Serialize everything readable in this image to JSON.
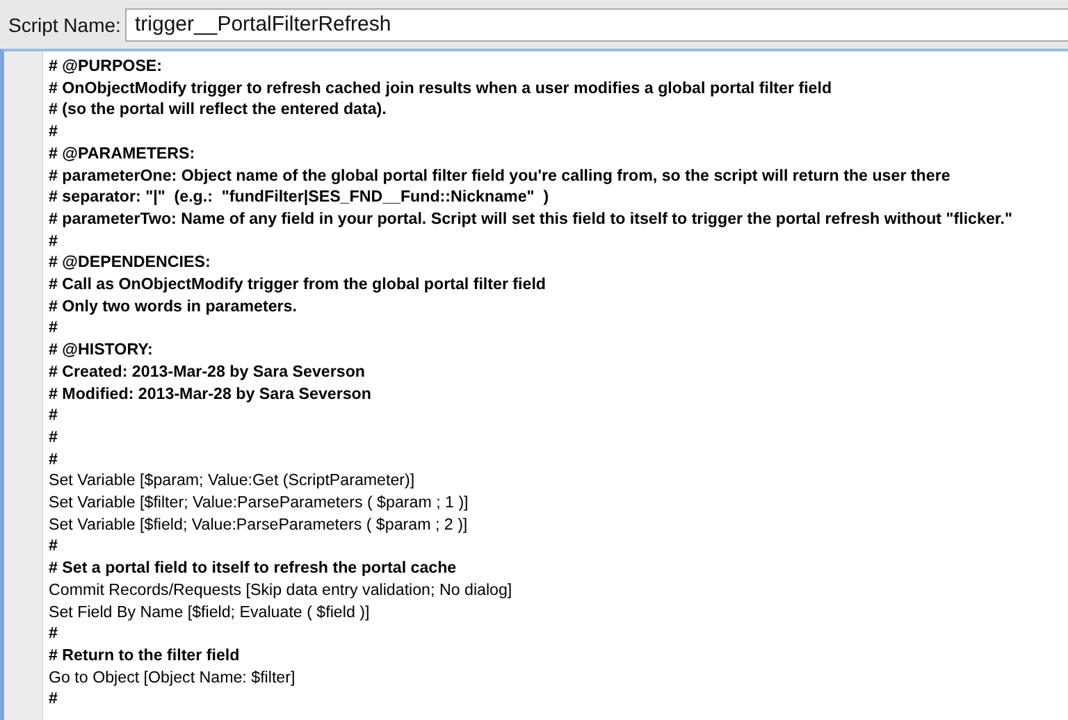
{
  "script_name": {
    "label": "Script Name:",
    "value": "trigger__PortalFilterRefresh"
  },
  "script_lines": [
    {
      "kind": "comment",
      "text": "# @PURPOSE:"
    },
    {
      "kind": "comment",
      "text": "# OnObjectModify trigger to refresh cached join results when a user modifies a global portal filter field"
    },
    {
      "kind": "comment",
      "text": "# (so the portal will reflect the entered data)."
    },
    {
      "kind": "comment",
      "text": "#"
    },
    {
      "kind": "comment",
      "text": "# @PARAMETERS:"
    },
    {
      "kind": "comment",
      "text": "# parameterOne: Object name of the global portal filter field you're calling from, so the script will return the user there"
    },
    {
      "kind": "comment",
      "text": "# separator: \"|\"  (e.g.:  \"fundFilter|SES_FND__Fund::Nickname\"  )"
    },
    {
      "kind": "comment",
      "text": "# parameterTwo: Name of any field in your portal. Script will set this field to itself to trigger the portal refresh without \"flicker.\""
    },
    {
      "kind": "comment",
      "text": "#"
    },
    {
      "kind": "comment",
      "text": "# @DEPENDENCIES:"
    },
    {
      "kind": "comment",
      "text": "# Call as OnObjectModify trigger from the global portal filter field"
    },
    {
      "kind": "comment",
      "text": "# Only two words in parameters."
    },
    {
      "kind": "comment",
      "text": "#"
    },
    {
      "kind": "comment",
      "text": "# @HISTORY:"
    },
    {
      "kind": "comment",
      "text": "# Created: 2013-Mar-28 by Sara Severson"
    },
    {
      "kind": "comment",
      "text": "# Modified: 2013-Mar-28 by Sara Severson"
    },
    {
      "kind": "comment",
      "text": "#"
    },
    {
      "kind": "comment",
      "text": "#"
    },
    {
      "kind": "comment",
      "text": "#"
    },
    {
      "kind": "step",
      "text": "Set Variable [$param; Value:Get (ScriptParameter)]"
    },
    {
      "kind": "step",
      "text": "Set Variable [$filter; Value:ParseParameters ( $param ; 1 )]"
    },
    {
      "kind": "step",
      "text": "Set Variable [$field; Value:ParseParameters ( $param ; 2 )]"
    },
    {
      "kind": "comment",
      "text": "#"
    },
    {
      "kind": "comment",
      "text": "# Set a portal field to itself to refresh the portal cache"
    },
    {
      "kind": "step",
      "text": "Commit Records/Requests [Skip data entry validation; No dialog]"
    },
    {
      "kind": "step",
      "text": "Set Field By Name [$field; Evaluate ( $field )]"
    },
    {
      "kind": "comment",
      "text": "#"
    },
    {
      "kind": "comment",
      "text": "# Return to the filter field"
    },
    {
      "kind": "step",
      "text": "Go to Object [Object Name: $filter]"
    },
    {
      "kind": "comment",
      "text": "#"
    }
  ]
}
